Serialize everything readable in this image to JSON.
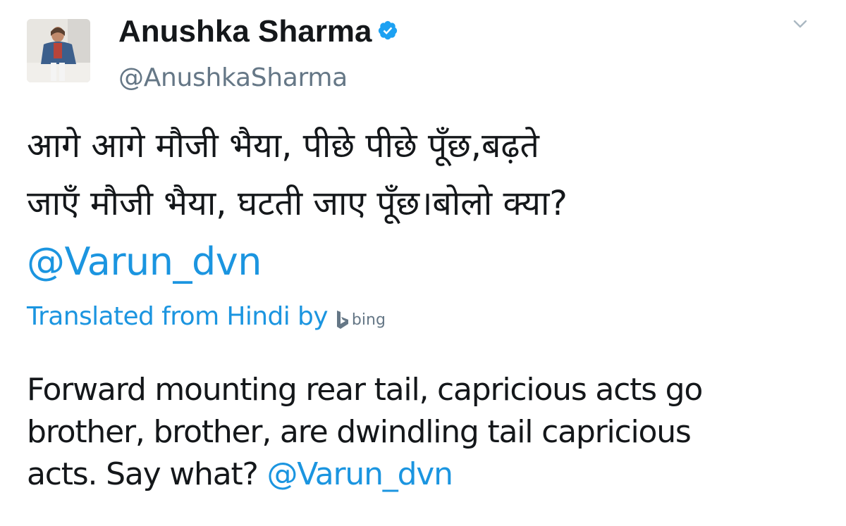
{
  "author": {
    "name": "Anushka Sharma",
    "handle": "@AnushkaSharma",
    "verified": true,
    "avatar_icon": "profile-photo"
  },
  "menu": {
    "icon": "chevron-down-icon"
  },
  "tweet": {
    "hindi_lines": [
      "आगे आगे मौजी भैया, पीछे पीछे पूँछ,बढ़ते",
      "जाएँ मौजी भैया, घटती जाए पूँछ।बोलो क्या?"
    ],
    "mention": "@Varun_dvn"
  },
  "translation": {
    "label": "Translated from Hindi by",
    "provider": "bing",
    "lines": [
      "Forward mounting rear tail, capricious acts go",
      "brother, brother, are dwindling tail capricious",
      "acts. Say what?"
    ],
    "mention": "@Varun_dvn"
  },
  "colors": {
    "link": "#1b95e0",
    "secondary_text": "#657786",
    "primary_text": "#14171a",
    "verified": "#1da1f2"
  }
}
